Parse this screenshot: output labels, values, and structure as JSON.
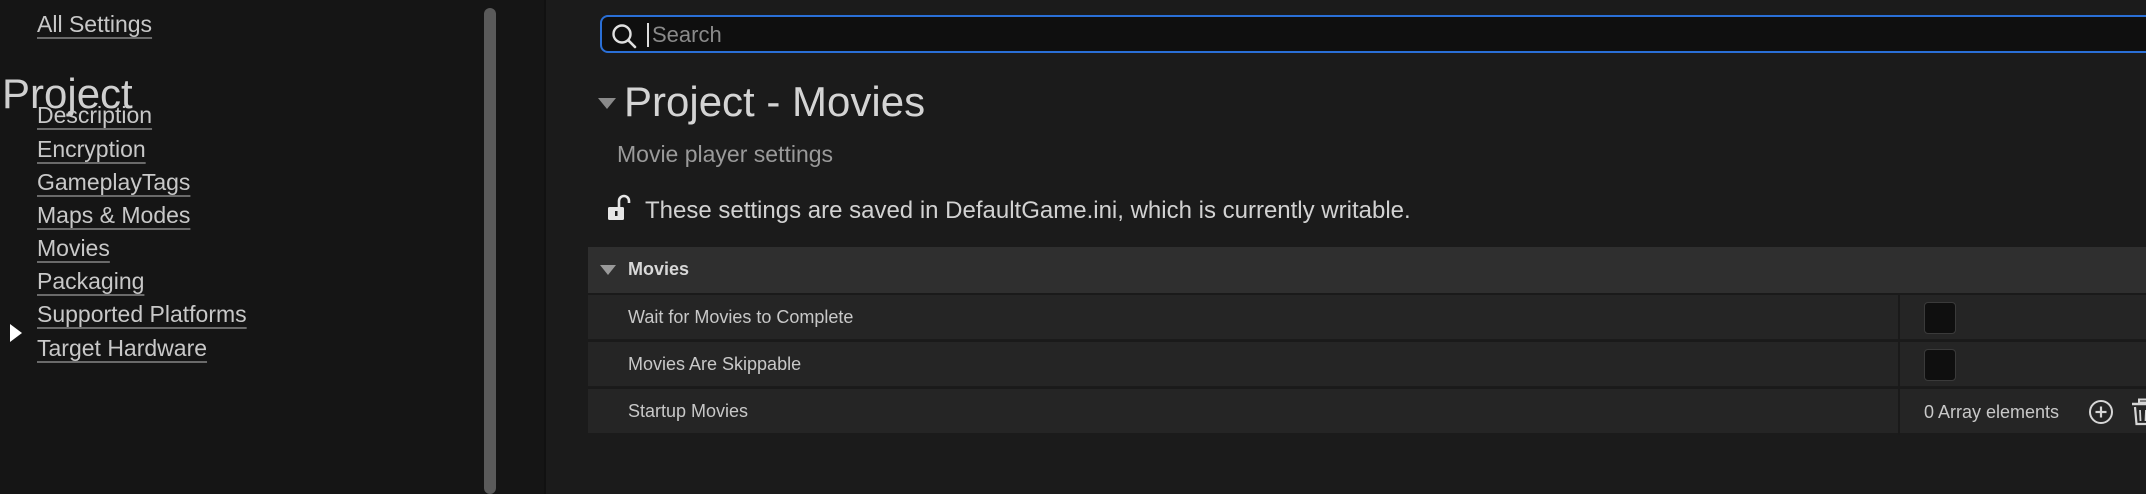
{
  "sidebar": {
    "all_settings": "All Settings",
    "section_heading": "Project",
    "items": [
      {
        "label": "Description"
      },
      {
        "label": "Encryption"
      },
      {
        "label": "GameplayTags"
      },
      {
        "label": "Maps & Modes"
      },
      {
        "label": "Movies",
        "selected": true
      },
      {
        "label": "Packaging"
      },
      {
        "label": "Supported Platforms"
      },
      {
        "label": "Target Hardware"
      }
    ]
  },
  "search": {
    "placeholder": "Search",
    "value": ""
  },
  "main": {
    "title": "Project - Movies",
    "subtitle": "Movie player settings",
    "save_note": "These settings are saved in DefaultGame.ini, which is currently writable.",
    "category": {
      "label": "Movies",
      "properties": [
        {
          "label": "Wait for Movies to Complete",
          "type": "checkbox",
          "checked": false
        },
        {
          "label": "Movies Are Skippable",
          "type": "checkbox",
          "checked": false
        },
        {
          "label": "Startup Movies",
          "type": "array",
          "value": "0 Array elements"
        }
      ]
    }
  },
  "colors": {
    "accent": "#2a6fd6",
    "background": "#151515",
    "panel": "#1b1b1b",
    "category_row": "#2f2f2f",
    "property_row": "#252525"
  },
  "icons": {
    "search": "search-icon",
    "lock": "unlocked-padlock-icon",
    "add": "plus-circle-icon",
    "delete": "trash-icon",
    "selected_marker": "triangle-right-icon",
    "collapse": "triangle-down-icon"
  }
}
